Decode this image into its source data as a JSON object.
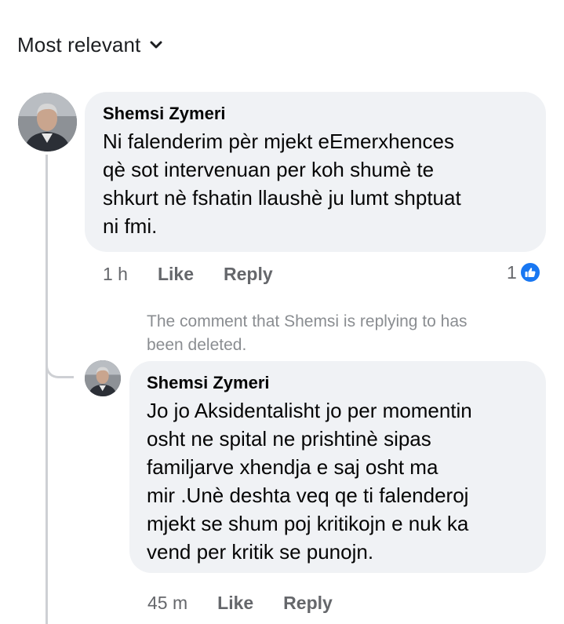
{
  "sort": {
    "label": "Most relevant",
    "icon": "chevron-down-icon"
  },
  "comments": [
    {
      "author": "Shemsi Zymeri",
      "text": "Ni falenderim pèr mjekt eEmerxhences\nqè sot intervenuan per koh shumè te\nshkurt nè fshatin llaushè ju lumt shptuat\nni fmi.",
      "time": "1 h",
      "like_label": "Like",
      "reply_label": "Reply",
      "reaction_count": "1",
      "reaction_icon": "thumbs-up-icon",
      "reaction_color": "#1877f2"
    }
  ],
  "deleted_note": "The comment that Shemsi is replying to has\nbeen deleted.",
  "reply": {
    "author": "Shemsi Zymeri",
    "text": "Jo jo Aksidentalisht jo per momentin\nosht ne spital ne prishtinè sipas\nfamiljarve xhendja e saj osht ma\nmir .Unè deshta veq qe ti falenderoj\nmjekt se shum poj kritikojn e  nuk ka\nvend per kritik se punojn.",
    "time": "45 m",
    "like_label": "Like",
    "reply_label": "Reply"
  },
  "colors": {
    "bubble": "#f0f2f5",
    "meta": "#65676b",
    "thread_line": "#ced0d4"
  }
}
